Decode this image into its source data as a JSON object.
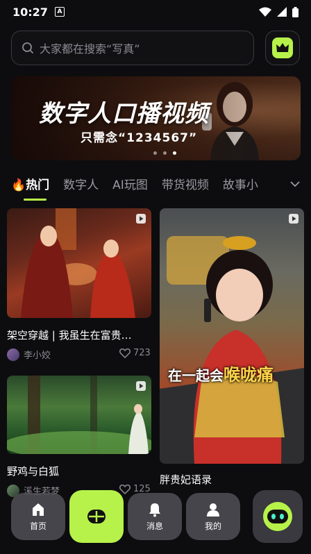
{
  "status_bar": {
    "time": "10:27",
    "badge": "A"
  },
  "search": {
    "placeholder": "大家都在搜索“写真”"
  },
  "banner": {
    "title": "数字人口播视频",
    "subtitle": "只需念“1234567”",
    "slide_count": 3,
    "active_slide": 3
  },
  "tabs": [
    {
      "label": "热门",
      "icon": "fire-icon",
      "active": true
    },
    {
      "label": "数字人",
      "active": false
    },
    {
      "label": "AI玩图",
      "active": false
    },
    {
      "label": "带货视频",
      "active": false
    },
    {
      "label": "故事小",
      "active": false
    }
  ],
  "feed": [
    {
      "title": "架空穿越 | 我虽生在富贵…",
      "author": "李小姣",
      "likes": "723"
    },
    {
      "title": "胖贵妃语录",
      "caption_prefix": "在一起会",
      "caption_highlight": "喉咙痛"
    },
    {
      "title": "野鸡与白狐",
      "author": "溪生若梦",
      "likes": "125"
    }
  ],
  "bottom_nav": {
    "home": "首页",
    "messages": "消息",
    "profile": "我的"
  },
  "colors": {
    "accent": "#b7f24a",
    "background": "#0d0d0f"
  }
}
